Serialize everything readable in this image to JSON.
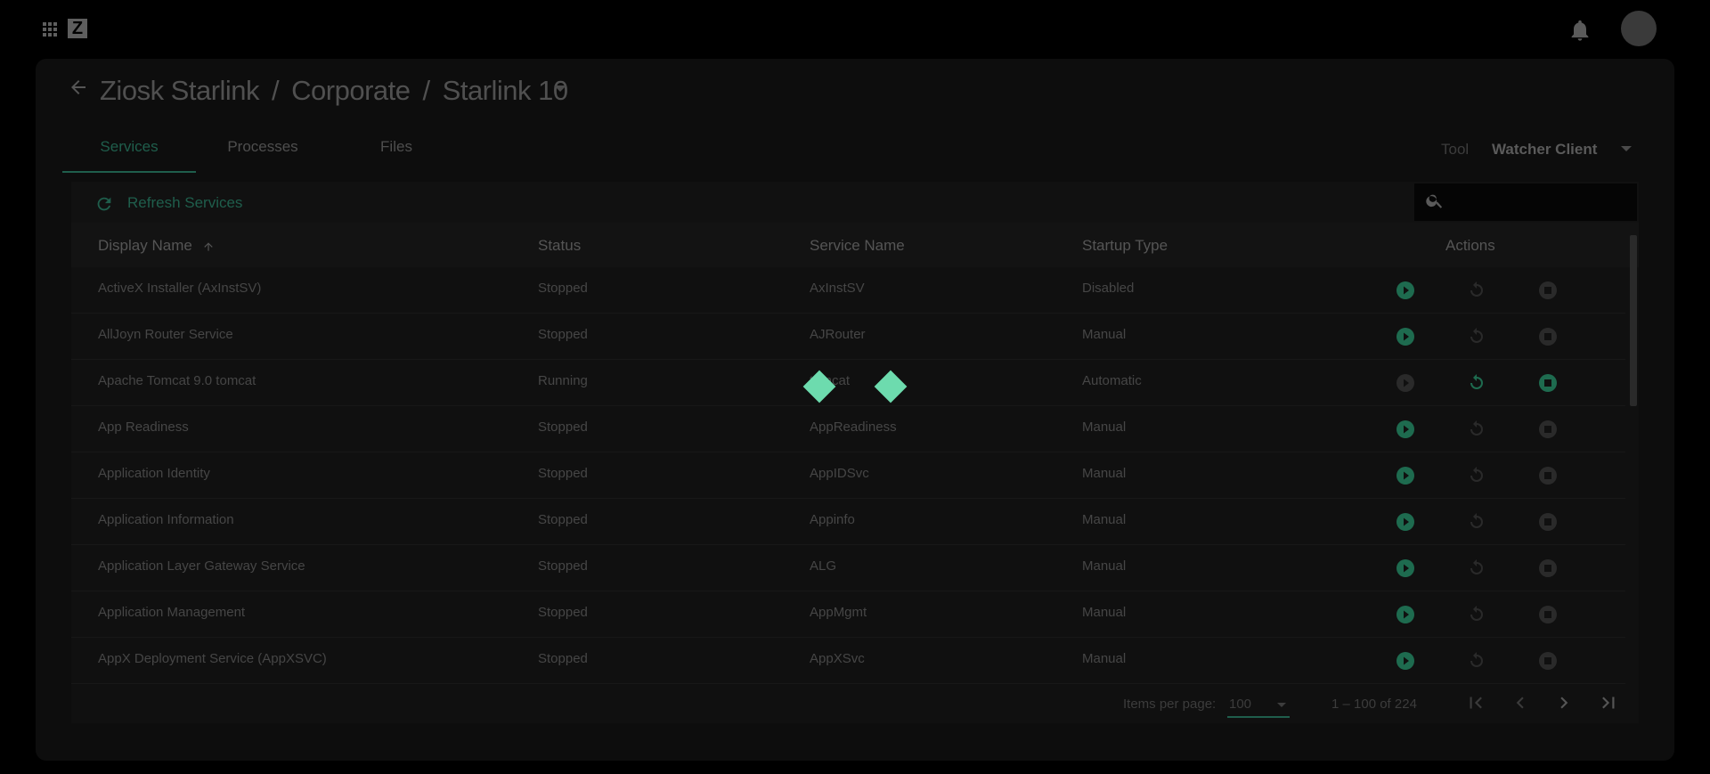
{
  "app": {
    "icons": {
      "apps": "apps-grid-icon",
      "logo": "Z",
      "notifications": "bell-icon",
      "avatar": "user-avatar"
    }
  },
  "header": {
    "breadcrumb": [
      "Ziosk Starlink",
      "Corporate",
      "Starlink 10"
    ],
    "separator": "/"
  },
  "tabs": [
    {
      "label": "Services",
      "active": true
    },
    {
      "label": "Processes",
      "active": false
    },
    {
      "label": "Files",
      "active": false
    }
  ],
  "tool": {
    "label": "Tool",
    "value": "Watcher Client"
  },
  "toolbar": {
    "refresh_label": "Refresh Services",
    "search_placeholder": ""
  },
  "table": {
    "columns": [
      "Display Name",
      "Status",
      "Service Name",
      "Startup Type",
      "Actions"
    ],
    "sort": {
      "column": "Display Name",
      "direction": "asc"
    },
    "rows": [
      {
        "display_name": "ActiveX Installer (AxInstSV)",
        "status": "Stopped",
        "service_name": "AxInstSV",
        "startup_type": "Disabled",
        "running": false
      },
      {
        "display_name": "AllJoyn Router Service",
        "status": "Stopped",
        "service_name": "AJRouter",
        "startup_type": "Manual",
        "running": false
      },
      {
        "display_name": "Apache Tomcat 9.0 tomcat",
        "status": "Running",
        "service_name": "tomcat",
        "startup_type": "Automatic",
        "running": true
      },
      {
        "display_name": "App Readiness",
        "status": "Stopped",
        "service_name": "AppReadiness",
        "startup_type": "Manual",
        "running": false
      },
      {
        "display_name": "Application Identity",
        "status": "Stopped",
        "service_name": "AppIDSvc",
        "startup_type": "Manual",
        "running": false
      },
      {
        "display_name": "Application Information",
        "status": "Stopped",
        "service_name": "Appinfo",
        "startup_type": "Manual",
        "running": false
      },
      {
        "display_name": "Application Layer Gateway Service",
        "status": "Stopped",
        "service_name": "ALG",
        "startup_type": "Manual",
        "running": false
      },
      {
        "display_name": "Application Management",
        "status": "Stopped",
        "service_name": "AppMgmt",
        "startup_type": "Manual",
        "running": false
      },
      {
        "display_name": "AppX Deployment Service (AppXSVC)",
        "status": "Stopped",
        "service_name": "AppXSvc",
        "startup_type": "Manual",
        "running": false
      }
    ]
  },
  "paginator": {
    "items_per_page_label": "Items per page:",
    "items_per_page": "100",
    "range_label": "1 – 100 of 224"
  },
  "colors": {
    "accent": "#1f5e4c",
    "spinner": "#6ddbae",
    "active_icon": "#1e6b4f",
    "disabled_icon": "#2a2a2a"
  }
}
